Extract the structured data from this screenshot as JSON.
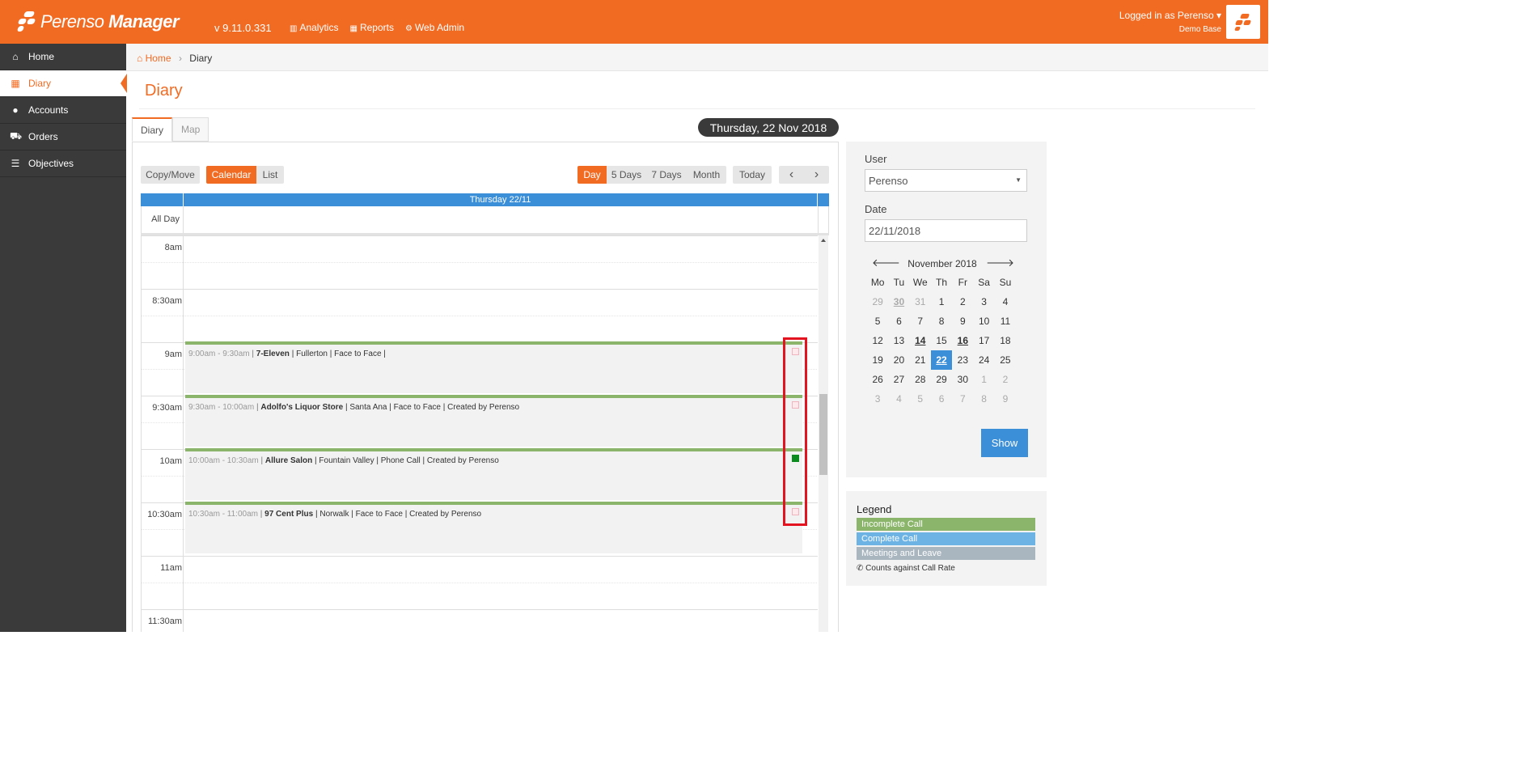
{
  "app": {
    "brand_plain": "Perenso",
    "brand_bold": "Manager",
    "version": "v 9.11.0.331"
  },
  "topnav": [
    {
      "label": "Analytics",
      "icon": "chart-icon"
    },
    {
      "label": "Reports",
      "icon": "table-icon"
    },
    {
      "label": "Web Admin",
      "icon": "cogs-icon"
    }
  ],
  "user": {
    "logged_in": "Logged in as Perenso",
    "database": "Demo Base"
  },
  "sidebar": {
    "items": [
      {
        "label": "Home",
        "icon": "home-icon"
      },
      {
        "label": "Diary",
        "icon": "calendar-icon"
      },
      {
        "label": "Accounts",
        "icon": "users-icon"
      },
      {
        "label": "Orders",
        "icon": "cart-icon"
      },
      {
        "label": "Objectives",
        "icon": "objectives-icon"
      }
    ]
  },
  "breadcrumb": {
    "home": "Home",
    "current": "Diary"
  },
  "page": {
    "title": "Diary",
    "date_banner": "Thursday, 22 Nov 2018"
  },
  "tabs": [
    "Diary",
    "Map"
  ],
  "toolbar": {
    "copy_move": "Copy/Move",
    "calendar": "Calendar",
    "list": "List",
    "day": "Day",
    "five_days": "5 Days",
    "seven_days": "7 Days",
    "month": "Month",
    "today": "Today",
    "prev": "‹",
    "next": "›"
  },
  "calendar": {
    "column_header": "Thursday 22/11",
    "all_day": "All Day",
    "times": [
      "8am",
      "8:30am",
      "9am",
      "9:30am",
      "10am",
      "10:30am",
      "11am",
      "11:30am"
    ],
    "events": [
      {
        "time": "9:00am - 9:30am",
        "account": "7-Eleven",
        "details": "| Fullerton | Face to Face |",
        "marker": "faded"
      },
      {
        "time": "9:30am - 10:00am",
        "account": "Adolfo's Liquor Store",
        "details": "| Santa Ana | Face to Face | Created by Perenso",
        "marker": "faded"
      },
      {
        "time": "10:00am - 10:30am",
        "account": "Allure Salon",
        "details": "| Fountain Valley | Phone Call | Created by Perenso",
        "marker": "green"
      },
      {
        "time": "10:30am - 11:00am",
        "account": "97 Cent Plus",
        "details": "| Norwalk | Face to Face | Created by Perenso",
        "marker": "faded"
      }
    ]
  },
  "filter": {
    "user_label": "User",
    "user_value": "Perenso",
    "date_label": "Date",
    "date_value": "22/11/2018",
    "show_button": "Show"
  },
  "minical": {
    "month": "November 2018",
    "dow": [
      "Mo",
      "Tu",
      "We",
      "Th",
      "Fr",
      "Sa",
      "Su"
    ],
    "days": [
      {
        "d": "29",
        "c": "muted"
      },
      {
        "d": "30",
        "c": "muted ul"
      },
      {
        "d": "31",
        "c": "muted"
      },
      {
        "d": "1",
        "c": ""
      },
      {
        "d": "2",
        "c": ""
      },
      {
        "d": "3",
        "c": ""
      },
      {
        "d": "4",
        "c": ""
      },
      {
        "d": "5",
        "c": ""
      },
      {
        "d": "6",
        "c": ""
      },
      {
        "d": "7",
        "c": ""
      },
      {
        "d": "8",
        "c": ""
      },
      {
        "d": "9",
        "c": ""
      },
      {
        "d": "10",
        "c": ""
      },
      {
        "d": "11",
        "c": ""
      },
      {
        "d": "12",
        "c": ""
      },
      {
        "d": "13",
        "c": ""
      },
      {
        "d": "14",
        "c": "ul"
      },
      {
        "d": "15",
        "c": ""
      },
      {
        "d": "16",
        "c": "ul"
      },
      {
        "d": "17",
        "c": ""
      },
      {
        "d": "18",
        "c": ""
      },
      {
        "d": "19",
        "c": ""
      },
      {
        "d": "20",
        "c": ""
      },
      {
        "d": "21",
        "c": ""
      },
      {
        "d": "22",
        "c": "sel"
      },
      {
        "d": "23",
        "c": ""
      },
      {
        "d": "24",
        "c": ""
      },
      {
        "d": "25",
        "c": ""
      },
      {
        "d": "26",
        "c": ""
      },
      {
        "d": "27",
        "c": ""
      },
      {
        "d": "28",
        "c": ""
      },
      {
        "d": "29",
        "c": ""
      },
      {
        "d": "30",
        "c": ""
      },
      {
        "d": "1",
        "c": "muted"
      },
      {
        "d": "2",
        "c": "muted"
      },
      {
        "d": "3",
        "c": "muted"
      },
      {
        "d": "4",
        "c": "muted"
      },
      {
        "d": "5",
        "c": "muted"
      },
      {
        "d": "6",
        "c": "muted"
      },
      {
        "d": "7",
        "c": "muted"
      },
      {
        "d": "8",
        "c": "muted"
      },
      {
        "d": "9",
        "c": "muted"
      }
    ]
  },
  "legend": {
    "title": "Legend",
    "items": [
      {
        "label": "Incomplete Call",
        "color": "#8ab56a"
      },
      {
        "label": "Complete Call",
        "color": "#6db3e4"
      },
      {
        "label": "Meetings and Leave",
        "color": "#a9b6bf"
      }
    ],
    "note": "Counts against Call Rate"
  },
  "colors": {
    "brand": "#f26b23",
    "sidebar": "#3a3a3a",
    "accent_blue": "#3b8ed8"
  }
}
